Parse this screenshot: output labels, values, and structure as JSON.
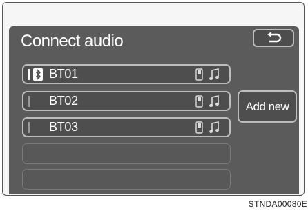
{
  "screen": {
    "title": "Connect audio",
    "back_icon": "back-arrow-icon",
    "add_new_label": "Add new"
  },
  "devices": [
    {
      "name": "BT01",
      "connected": true,
      "icons": [
        "bluetooth-icon",
        "phone-icon",
        "music-note-icon"
      ]
    },
    {
      "name": "BT02",
      "connected": false,
      "icons": [
        "phone-icon",
        "music-note-icon"
      ]
    },
    {
      "name": "BT03",
      "connected": false,
      "icons": [
        "phone-icon",
        "music-note-icon"
      ]
    }
  ],
  "empty_slots": 2,
  "figure_code": "STNDA00080E",
  "colors": {
    "screen_bg": "#5b5b5b",
    "button_border": "#bdbdbd",
    "text": "#ffffff"
  }
}
